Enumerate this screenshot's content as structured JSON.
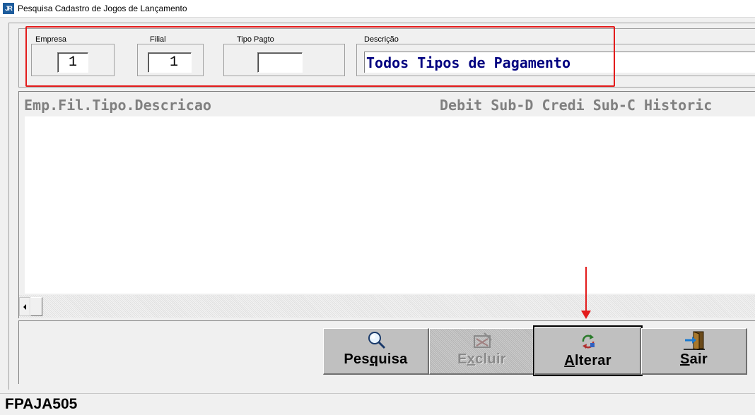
{
  "window": {
    "icon_text": "JR",
    "title": "Pesquisa Cadastro de Jogos de Lançamento"
  },
  "filters": {
    "empresa": {
      "label": "Empresa",
      "value": "1"
    },
    "filial": {
      "label": "Filial",
      "value": "1"
    },
    "tipo_pagto": {
      "label": "Tipo Pagto",
      "value": ""
    },
    "descricao": {
      "label": "Descrição",
      "value": "Todos Tipos de Pagamento"
    }
  },
  "list": {
    "header_left": "Emp.Fil.Tipo.Descricao",
    "header_right": "Debit Sub-D Credi Sub-C Historic",
    "rows": []
  },
  "buttons": {
    "pesquisa": {
      "label": "Pesquisa",
      "icon": "magnifier-icon",
      "enabled": true
    },
    "excluir": {
      "label": "Excluir",
      "icon": "delete-icon",
      "enabled": false
    },
    "alterar": {
      "label": "Alterar",
      "icon": "refresh-edit-icon",
      "enabled": true,
      "focused": true
    },
    "sair": {
      "label": "Sair",
      "icon": "exit-door-icon",
      "enabled": true
    }
  },
  "status": {
    "program_code": "FPAJA505"
  },
  "annotations": {
    "highlight_color": "#e31b1b"
  }
}
